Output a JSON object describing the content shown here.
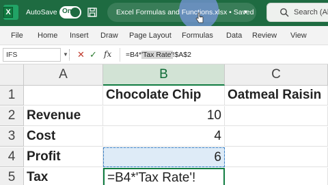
{
  "titlebar": {
    "autosave_label": "AutoSave",
    "autosave_state": "On",
    "document_title": "Excel Formulas and Functions.xlsx • Saved",
    "search_placeholder": "Search (Al",
    "icons": [
      "excel-logo",
      "save-icon",
      "undo-icon",
      "dropdown-icon",
      "search-icon"
    ],
    "bar_color": "#1e6b41"
  },
  "menu": {
    "items": [
      "File",
      "Home",
      "Insert",
      "Draw",
      "Page Layout",
      "Formulas",
      "Data",
      "Review",
      "View"
    ]
  },
  "formula_bar": {
    "name_box": "IFS",
    "cancel_symbol": "✕",
    "enter_symbol": "✓",
    "fx_label": "fx",
    "formula_prefix": "=B4*",
    "formula_selected": "'Tax Rate'",
    "formula_suffix": "!$A$2"
  },
  "grid": {
    "columns": [
      "A",
      "B",
      "C"
    ],
    "active_column": "B",
    "rows": [
      {
        "num": "1",
        "A": "",
        "B": "Chocolate Chip",
        "C": "Oatmeal Raisin"
      },
      {
        "num": "2",
        "A": "Revenue",
        "B": "10",
        "C": ""
      },
      {
        "num": "3",
        "A": "Cost",
        "B": "4",
        "C": ""
      },
      {
        "num": "4",
        "A": "Profit",
        "B": "6",
        "C": ""
      },
      {
        "num": "5",
        "A": "Tax",
        "B": "=B4*'Tax Rate'!",
        "C": ""
      }
    ],
    "accent_color": "#107c41",
    "reference_color": "#3b7fc4"
  }
}
